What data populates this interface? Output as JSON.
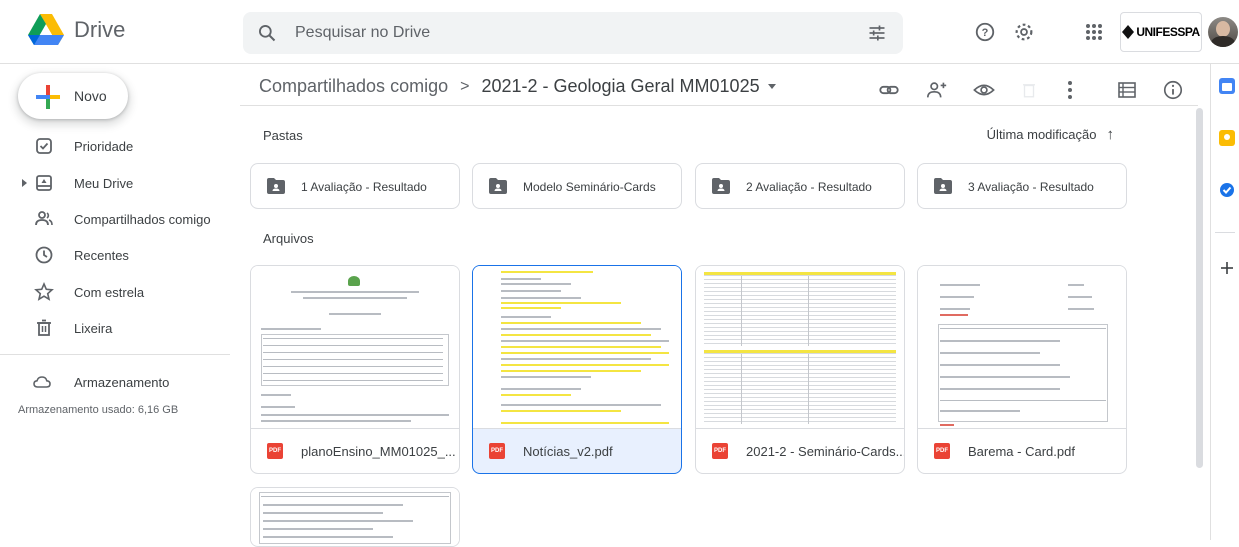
{
  "app": {
    "name": "Drive"
  },
  "search": {
    "placeholder": "Pesquisar no Drive"
  },
  "header": {
    "brand": "UNIFESSPA"
  },
  "sidebar": {
    "new_label": "Novo",
    "items": [
      {
        "label": "Prioridade"
      },
      {
        "label": "Meu Drive"
      },
      {
        "label": "Compartilhados comigo"
      },
      {
        "label": "Recentes"
      },
      {
        "label": "Com estrela"
      },
      {
        "label": "Lixeira"
      },
      {
        "label": "Armazenamento"
      }
    ],
    "storage_used": "Armazenamento usado: 6,16 GB"
  },
  "breadcrumb": {
    "parent": "Compartilhados comigo",
    "separator": ">",
    "current": "2021-2 - Geologia Geral MM01025"
  },
  "sections": {
    "folders": "Pastas",
    "files": "Arquivos"
  },
  "sort": {
    "label": "Última modificação",
    "arrow": "↑"
  },
  "folders": [
    {
      "name": "1 Avaliação - Resultado"
    },
    {
      "name": "Modelo Seminário-Cards"
    },
    {
      "name": "2 Avaliação - Resultado"
    },
    {
      "name": "3 Avaliação - Resultado"
    }
  ],
  "files": [
    {
      "name": "planoEnsino_MM01025_...",
      "type": "PDF"
    },
    {
      "name": "Notícias_v2.pdf",
      "type": "PDF",
      "selected": true
    },
    {
      "name": "2021-2 - Seminário-Cards...",
      "type": "PDF"
    },
    {
      "name": "Barema - Card.pdf",
      "type": "PDF"
    }
  ],
  "colors": {
    "accent": "#1a73e8",
    "pdf": "#ea4335",
    "selected_bg": "#e8f0fe"
  }
}
